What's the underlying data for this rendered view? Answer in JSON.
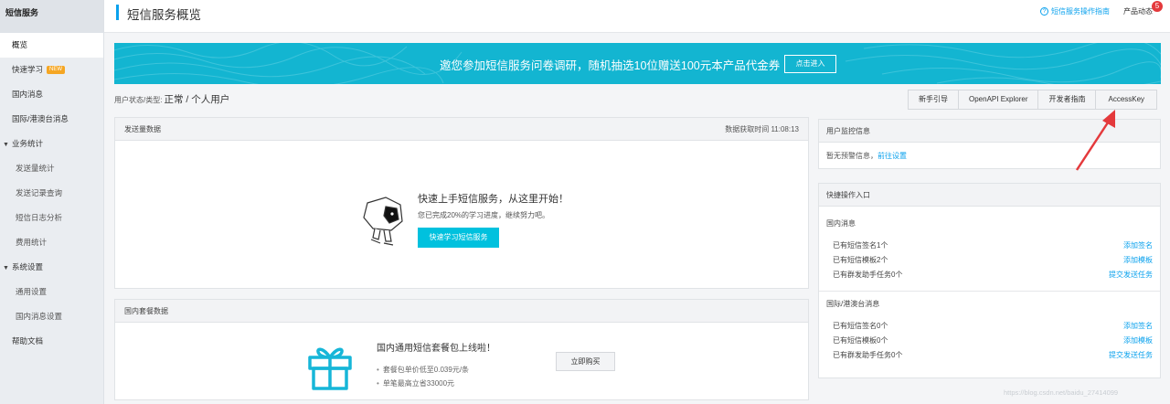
{
  "sidebar": {
    "title": "短信服务",
    "items": [
      {
        "label": "概览",
        "active": true,
        "type": "item"
      },
      {
        "label": "快速学习",
        "badge": "NEW",
        "type": "item"
      },
      {
        "label": "国内消息",
        "type": "item"
      },
      {
        "label": "国际/港澳台消息",
        "type": "item"
      },
      {
        "label": "业务统计",
        "type": "group"
      },
      {
        "label": "发送量统计",
        "type": "sub"
      },
      {
        "label": "发送记录查询",
        "type": "sub"
      },
      {
        "label": "短信日志分析",
        "type": "sub"
      },
      {
        "label": "费用统计",
        "type": "sub"
      },
      {
        "label": "系统设置",
        "type": "group"
      },
      {
        "label": "通用设置",
        "type": "sub"
      },
      {
        "label": "国内消息设置",
        "type": "sub"
      },
      {
        "label": "帮助文档",
        "type": "item"
      }
    ]
  },
  "header": {
    "title": "短信服务概览",
    "guide_link": "短信服务操作指南",
    "news": "产品动态",
    "news_count": "5"
  },
  "banner": {
    "text": "邀您参加短信服务问卷调研，随机抽选10位赠送100元本产品代金券",
    "button": "点击进入"
  },
  "status": {
    "label": "用户状态/类型:",
    "value": "正常 / 个人用户"
  },
  "toolbar": {
    "buttons": [
      "新手引导",
      "OpenAPI Explorer",
      "开发者指南",
      "AccessKey"
    ]
  },
  "send_panel": {
    "title": "发送量数据",
    "fetch_time": "数据获取时间 11:08:13",
    "cta_title": "快速上手短信服务，从这里开始！",
    "cta_sub": "您已完成20%的学习进度，继续努力吧。",
    "cta_button": "快速学习短信服务"
  },
  "package_panel": {
    "title": "国内套餐数据",
    "heading": "国内通用短信套餐包上线啦！",
    "bullets": [
      "套餐包单价低至0.039元/条",
      "单笔最高立省33000元"
    ],
    "button": "立即购买"
  },
  "monitor_panel": {
    "title": "用户监控信息",
    "text": "暂无预警信息，",
    "link": "前往设置"
  },
  "quick_panel": {
    "title": "快捷操作入口",
    "domestic": {
      "title": "国内消息",
      "rows": [
        {
          "label": "已有短信签名1个",
          "action": "添加签名"
        },
        {
          "label": "已有短信模板2个",
          "action": "添加模板"
        },
        {
          "label": "已有群发助手任务0个",
          "action": "提交发送任务"
        }
      ]
    },
    "intl": {
      "title": "国际/港澳台消息",
      "rows": [
        {
          "label": "已有短信签名0个",
          "action": "添加签名"
        },
        {
          "label": "已有短信模板0个",
          "action": "添加模板"
        },
        {
          "label": "已有群发助手任务0个",
          "action": "提交发送任务"
        }
      ]
    }
  },
  "watermark": "https://blog.csdn.net/baidu_27414099",
  "colors": {
    "accent": "#0aa1ed",
    "banner": "#13b5d1",
    "cta": "#00c1de",
    "arrow": "#e4393c"
  }
}
